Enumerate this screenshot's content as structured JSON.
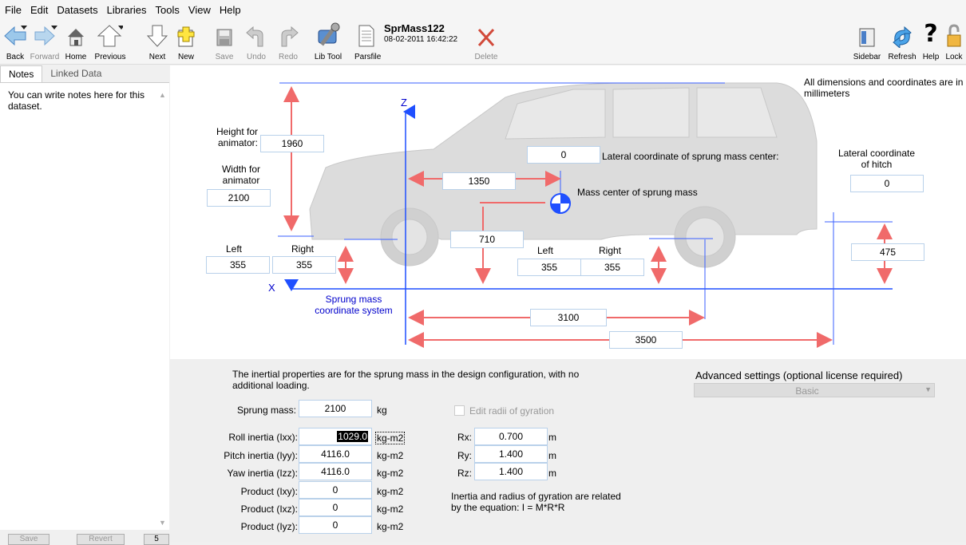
{
  "menu": [
    "File",
    "Edit",
    "Datasets",
    "Libraries",
    "Tools",
    "View",
    "Help"
  ],
  "toolbar": {
    "back": "Back",
    "forward": "Forward",
    "home": "Home",
    "previous": "Previous",
    "next": "Next",
    "new": "New",
    "save": "Save",
    "undo": "Undo",
    "redo": "Redo",
    "libtool": "Lib Tool",
    "parsfile": "Parsfile",
    "dataset_title": "SprMass122",
    "dataset_date": "08-02-2011 16:42:22",
    "delete": "Delete",
    "sidebar": "Sidebar",
    "refresh": "Refresh",
    "help": "Help",
    "lock": "Lock"
  },
  "left": {
    "tabs": [
      "Notes",
      "Linked Data"
    ],
    "notes": "You can write notes here for this dataset.",
    "save": "Save",
    "revert": "Revert",
    "extra": "5"
  },
  "diagram": {
    "info": "All dimensions and coordinates are in millimeters",
    "height_label": "Height for animator:",
    "height": "1960",
    "width_label": "Width for animator",
    "width": "2100",
    "lateral_cg_label": "Lateral coordinate of sprung mass center:",
    "lateral_cg": "0",
    "lateral_hitch_label": "Lateral coordinate of hitch",
    "lateral_hitch": "0",
    "cg_x": "1350",
    "cg_label": "Mass center of sprung mass",
    "cg_z": "710",
    "left": "Left",
    "right": "Right",
    "front_left": "355",
    "front_right": "355",
    "rear_left": "355",
    "rear_right": "355",
    "hitch_z": "475",
    "axis_x": "X",
    "axis_z": "Z",
    "coord_label": "Sprung mass coordinate system",
    "wheelbase": "3100",
    "hitch_x": "3500"
  },
  "props": {
    "intro": "The inertial properties are for the sprung mass in the design configuration, with no additional loading.",
    "mass_label": "Sprung mass:",
    "mass": "2100",
    "mass_unit": "kg",
    "edit_radii": "Edit radii of gyration",
    "ixx_label": "Roll inertia (Ixx):",
    "ixx": "1029.0",
    "iyy_label": "Pitch inertia (Iyy):",
    "iyy": "4116.0",
    "izz_label": "Yaw inertia (Izz):",
    "izz": "4116.0",
    "ixy_label": "Product (Ixy):",
    "ixy": "0",
    "ixz_label": "Product (Ixz):",
    "ixz": "0",
    "iyz_label": "Product (Iyz):",
    "iyz": "0",
    "inertia_unit": "kg-m2",
    "rx_label": "Rx:",
    "rx": "0.700",
    "ry_label": "Ry:",
    "ry": "1.400",
    "rz_label": "Rz:",
    "rz": "1.400",
    "r_unit": "m",
    "eq_note": "Inertia and radius of gyration are related by the equation: I = M*R*R",
    "advanced_label": "Advanced settings (optional license required)",
    "advanced_value": "Basic"
  }
}
